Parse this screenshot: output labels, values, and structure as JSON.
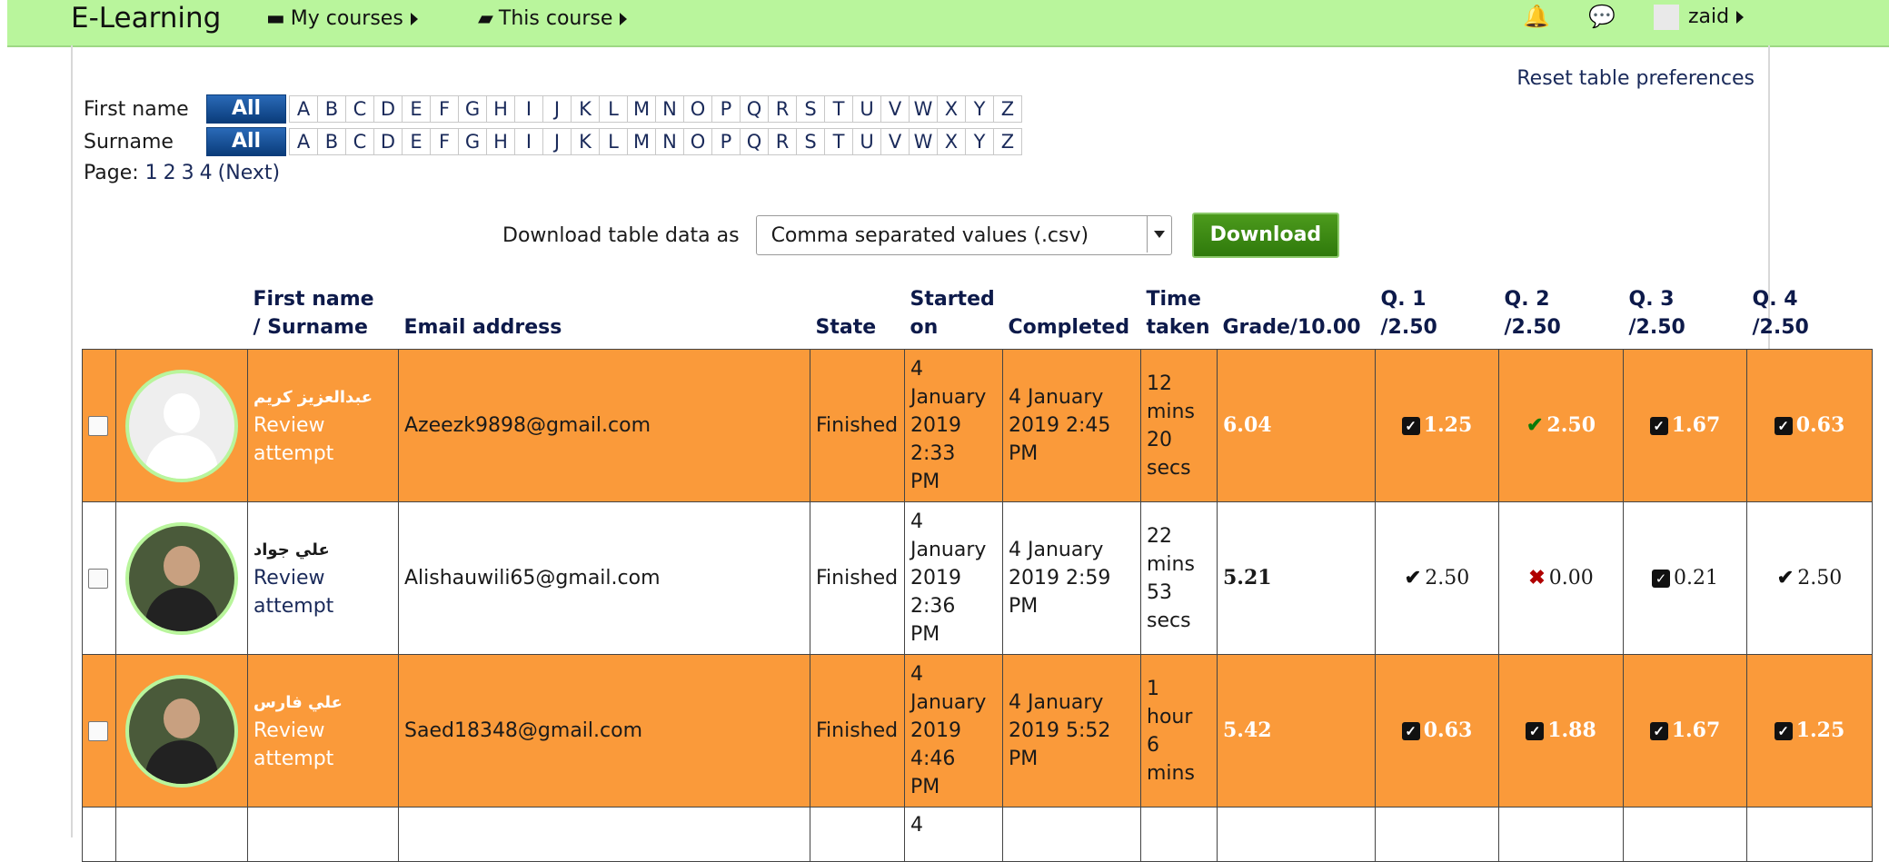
{
  "navbar": {
    "brand": "E-Learning",
    "my_courses": "My courses",
    "this_course": "This course",
    "user": "zaid",
    "icons": [
      "bell-icon",
      "chat-icon"
    ]
  },
  "reset_link": "Reset table preferences",
  "initials": {
    "first_label": "First name",
    "surname_label": "Surname",
    "all": "All",
    "letters": [
      "A",
      "B",
      "C",
      "D",
      "E",
      "F",
      "G",
      "H",
      "I",
      "J",
      "K",
      "L",
      "M",
      "N",
      "O",
      "P",
      "Q",
      "R",
      "S",
      "T",
      "U",
      "V",
      "W",
      "X",
      "Y",
      "Z"
    ]
  },
  "paging": {
    "label": "Page:",
    "pages": [
      "1",
      "2",
      "3",
      "4"
    ],
    "next": "(Next)"
  },
  "download": {
    "label": "Download table data as",
    "selected": "Comma separated values (.csv)",
    "button": "Download"
  },
  "headers": {
    "name_1": "First name",
    "name_2": "/ Surname",
    "email": "Email address",
    "state": "State",
    "started_1": "Started",
    "started_2": "on",
    "completed": "Completed",
    "time_1": "Time",
    "time_2": "taken",
    "grade": "Grade/10.00",
    "q1_1": "Q. 1",
    "q1_2": "/2.50",
    "q2_1": "Q. 2",
    "q2_2": "/2.50",
    "q3_1": "Q. 3",
    "q3_2": "/2.50",
    "q4_1": "Q. 4",
    "q4_2": "/2.50"
  },
  "rows": [
    {
      "name": "عبدالعزيز كريم",
      "review_1": "Review",
      "review_2": "attempt",
      "email": "Azeezk9898@gmail.com",
      "state": "Finished",
      "started": [
        "4",
        "January",
        "2019",
        "2:33",
        "PM"
      ],
      "completed": [
        "4 January",
        "2019 2:45",
        "PM"
      ],
      "time": [
        "12",
        "mins",
        "20",
        "secs"
      ],
      "grade": "6.04",
      "q": [
        "1.25",
        "2.50",
        "1.67",
        "0.63"
      ],
      "marks": [
        "partial",
        "correct",
        "partial",
        "partial"
      ]
    },
    {
      "name": "علي جواد",
      "review_1": "Review",
      "review_2": "attempt",
      "email": "Alishauwili65@gmail.com",
      "state": "Finished",
      "started": [
        "4",
        "January",
        "2019",
        "2:36",
        "PM"
      ],
      "completed": [
        "4 January",
        "2019 2:59",
        "PM"
      ],
      "time": [
        "22",
        "mins",
        "53",
        "secs"
      ],
      "grade": "5.21",
      "q": [
        "2.50",
        "0.00",
        "0.21",
        "2.50"
      ],
      "marks": [
        "correct",
        "incorrect",
        "partial",
        "correct"
      ]
    },
    {
      "name": "علي فارس",
      "review_1": "Review",
      "review_2": "attempt",
      "email": "Saed18348@gmail.com",
      "state": "Finished",
      "started": [
        "4",
        "January",
        "2019",
        "4:46",
        "PM"
      ],
      "completed": [
        "4 January",
        "2019 5:52",
        "PM"
      ],
      "time": [
        "1",
        "hour",
        "6",
        "mins"
      ],
      "grade": "5.42",
      "q": [
        "0.63",
        "1.88",
        "1.67",
        "1.25"
      ],
      "marks": [
        "partial",
        "partial",
        "partial",
        "partial"
      ]
    }
  ],
  "partial_row": {
    "started_first": "4"
  }
}
